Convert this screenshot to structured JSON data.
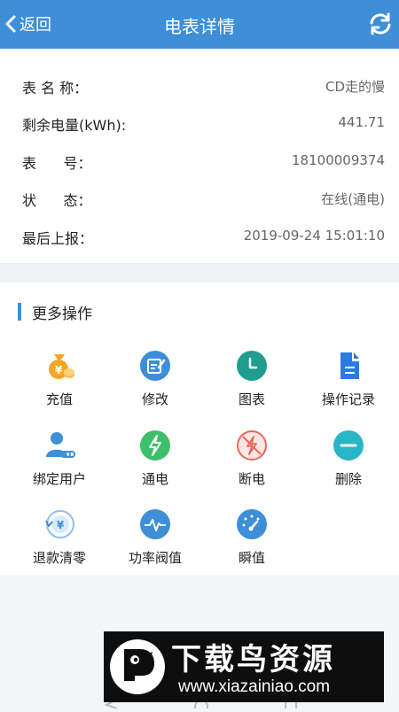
{
  "header": {
    "back_label": "返回",
    "title": "电表详情"
  },
  "meter": {
    "rows": [
      {
        "label": "表 名 称：",
        "value": "CD走的慢"
      },
      {
        "label": "剩余电量(kWh):",
        "value": "441.71"
      },
      {
        "label": "表      号：",
        "value": "18100009374"
      },
      {
        "label": "状      态：",
        "value": "在线(通电)"
      },
      {
        "label": "最后上报：",
        "value": "2019-09-24 15:01:10"
      }
    ]
  },
  "operations": {
    "section_title": "更多操作",
    "items": [
      {
        "label": "充值",
        "icon": "money-bag-icon",
        "color": "#f5a623"
      },
      {
        "label": "修改",
        "icon": "edit-icon",
        "color": "#3e8ed8"
      },
      {
        "label": "图表",
        "icon": "clock-icon",
        "color": "#1f9d8f"
      },
      {
        "label": "操作记录",
        "icon": "document-icon",
        "color": "#2a7be0"
      },
      {
        "label": "绑定用户",
        "icon": "user-link-icon",
        "color": "#3e8ed8"
      },
      {
        "label": "通电",
        "icon": "lightning-icon",
        "color": "#3fbf6a"
      },
      {
        "label": "断电",
        "icon": "power-off-icon",
        "color": "#e46a5e"
      },
      {
        "label": "删除",
        "icon": "minus-icon",
        "color": "#27b6c6"
      },
      {
        "label": "退款清零",
        "icon": "refund-icon",
        "color": "#3e8ed8"
      },
      {
        "label": "功率阀值",
        "icon": "pulse-icon",
        "color": "#3e8ed8"
      },
      {
        "label": "瞬值",
        "icon": "gauge-icon",
        "color": "#3e8ed8"
      }
    ]
  },
  "watermark": {
    "title": "下载鸟资源",
    "url": "www.xiazainiao.com"
  },
  "colors": {
    "primary": "#3e8ed8",
    "background": "#f3f6f9"
  }
}
